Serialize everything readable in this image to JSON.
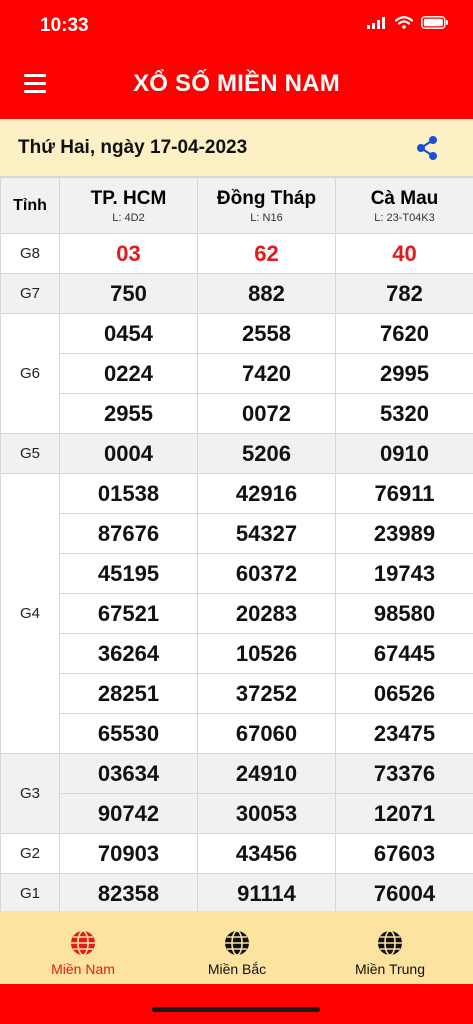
{
  "status": {
    "time": "10:33"
  },
  "header": {
    "title": "XỔ SỐ MIỀN NAM"
  },
  "date_label": "Thứ Hai, ngày 17-04-2023",
  "colors": {
    "brand_red": "#ff0000",
    "number_red": "#e31a1a",
    "cream": "#fcf0c4",
    "tab_bg": "#fce3a0"
  },
  "table": {
    "corner_label": "Tỉnh",
    "provinces": [
      {
        "name": "TP. HCM",
        "code": "L: 4D2"
      },
      {
        "name": "Đồng Tháp",
        "code": "L: N16"
      },
      {
        "name": "Cà Mau",
        "code": "L: 23-T04K3"
      }
    ],
    "prizes": [
      {
        "label": "G8",
        "rows": [
          [
            "03",
            "62",
            "40"
          ]
        ]
      },
      {
        "label": "G7",
        "rows": [
          [
            "750",
            "882",
            "782"
          ]
        ]
      },
      {
        "label": "G6",
        "rows": [
          [
            "0454",
            "2558",
            "7620"
          ],
          [
            "0224",
            "7420",
            "2995"
          ],
          [
            "2955",
            "0072",
            "5320"
          ]
        ]
      },
      {
        "label": "G5",
        "rows": [
          [
            "0004",
            "5206",
            "0910"
          ]
        ]
      },
      {
        "label": "G4",
        "rows": [
          [
            "01538",
            "42916",
            "76911"
          ],
          [
            "87676",
            "54327",
            "23989"
          ],
          [
            "45195",
            "60372",
            "19743"
          ],
          [
            "67521",
            "20283",
            "98580"
          ],
          [
            "36264",
            "10526",
            "67445"
          ],
          [
            "28251",
            "37252",
            "06526"
          ],
          [
            "65530",
            "67060",
            "23475"
          ]
        ]
      },
      {
        "label": "G3",
        "rows": [
          [
            "03634",
            "24910",
            "73376"
          ],
          [
            "90742",
            "30053",
            "12071"
          ]
        ]
      },
      {
        "label": "G2",
        "rows": [
          [
            "70903",
            "43456",
            "67603"
          ]
        ]
      },
      {
        "label": "G1",
        "rows": [
          [
            "82358",
            "91114",
            "76004"
          ]
        ]
      }
    ]
  },
  "tabs": [
    {
      "label": "Miền Nam",
      "icon": "globe-icon",
      "active": true
    },
    {
      "label": "Miền Bắc",
      "icon": "globe-icon",
      "active": false
    },
    {
      "label": "Miền Trung",
      "icon": "globe-icon",
      "active": false
    }
  ]
}
